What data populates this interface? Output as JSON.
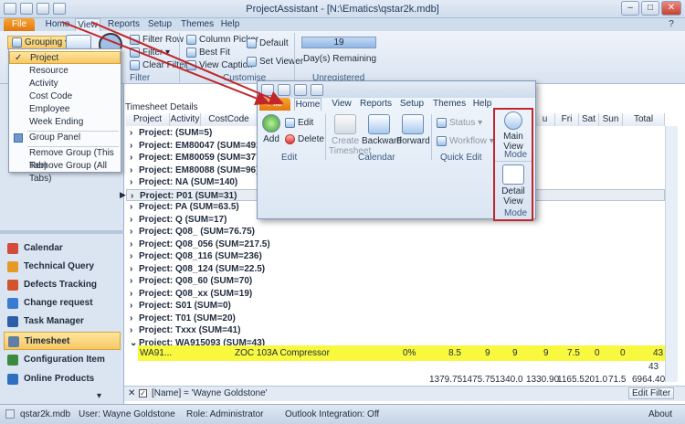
{
  "window": {
    "title": "ProjectAssistant - [N:\\Ematics\\qstar2k.mdb]",
    "minimize": "–",
    "maximize": "□",
    "close": "✕"
  },
  "tabs": {
    "file": "File",
    "home": "Home",
    "view": "View",
    "reports": "Reports",
    "setup": "Setup",
    "themes": "Themes",
    "help": "Help"
  },
  "ribbon": {
    "grouping": "Grouping",
    "filter_row": "Filter Row",
    "filter": "Filter",
    "clear_filter": "Clear Filter",
    "filter_group": "Filter",
    "column_picker": "Column Picker",
    "best_fit": "Best Fit",
    "view_caption": "View Caption",
    "default": "Default",
    "set_viewer": "Set Viewer",
    "customise_group": "Customise",
    "days_value": "19",
    "days_remaining": "Day(s) Remaining",
    "unregistered": "Unregistered"
  },
  "dropdown": {
    "items": [
      "Project",
      "Resource",
      "Activity",
      "Cost Code",
      "Employee",
      "Week Ending"
    ],
    "group_panel": "Group Panel",
    "remove_tab": "Remove Group (This Tab)",
    "remove_all": "Remove Group (All Tabs)"
  },
  "nav": {
    "items": [
      "Calendar",
      "Technical Query",
      "Defects Tracking",
      "Change request",
      "Task Manager",
      "Timesheet",
      "Configuration Item",
      "Online Products"
    ],
    "colors": [
      "#d24b3a",
      "#e49a25",
      "#d2532e",
      "#3a7bd2",
      "#2c5fa8",
      "#5f7fa8",
      "#3d8a3d",
      "#2f6fbf"
    ]
  },
  "grid": {
    "section_title": "Timesheet Details",
    "headers": [
      "Project",
      "Activity",
      "CostCode"
    ],
    "day_headers": [
      "u",
      "Fri",
      "Sat",
      "Sun",
      "Total"
    ],
    "groups": [
      "Project:  (SUM=5)",
      "Project: EM80047 (SUM=492.75)",
      "Project: EM80059 (SUM=377.5)",
      "Project: EM80088 (SUM=96)",
      "Project: NA (SUM=140)",
      "Project: P01 (SUM=31)",
      "Project: PA (SUM=63.5)",
      "Project: Q (SUM=17)",
      "Project: Q08_ (SUM=76.75)",
      "Project: Q08_056 (SUM=217.5)",
      "Project: Q08_116 (SUM=236)",
      "Project: Q08_124 (SUM=22.5)",
      "Project: Q08_60 (SUM=70)",
      "Project: Q08_xx (SUM=19)",
      "Project: S01 (SUM=0)",
      "Project: T01 (SUM=20)",
      "Project: Txxx (SUM=41)",
      "Project: WA915093 (SUM=43)"
    ],
    "detail_row": {
      "code": "WA91...",
      "desc": "ZOC 103A Compressor",
      "pct": "0%",
      "v1": "8.5",
      "v2": "9",
      "v3": "9",
      "v4": "9",
      "v5": "7.5",
      "v6": "0",
      "v7": "0",
      "total": "43"
    },
    "subtotal": "43",
    "totals": [
      "1379.75",
      "1475.75",
      "1340.0",
      "1330.90",
      "1165.5",
      "201.0",
      "71.5",
      "6964.40"
    ]
  },
  "filter": {
    "text": "[Name] = 'Wayne Goldstone'",
    "edit": "Edit Filter"
  },
  "status": {
    "db": "qstar2k.mdb",
    "user": "User: Wayne Goldstone",
    "role": "Role: Administrator",
    "outlook": "Outlook Integration: Off",
    "about": "About"
  },
  "overlay": {
    "tabs": [
      "File",
      "Home",
      "View",
      "Reports",
      "Setup",
      "Themes",
      "Help"
    ],
    "add": "Add",
    "edit": "Edit",
    "delete": "Delete",
    "edit_group": "Edit",
    "create_timesheet": "Create Timesheet",
    "backward": "Backward",
    "forward": "Forward",
    "calendar_group": "Calendar",
    "status": "Status",
    "workflow": "Workflow",
    "quick_edit": "Quick Edit",
    "main_view": "Main View",
    "mode1": "Mode",
    "detail_view": "Detail View",
    "mode2": "Mode"
  },
  "colors": {
    "accent": "#c0262b",
    "highlight": "#f8f83f",
    "file_tab": "#e98a1f"
  }
}
